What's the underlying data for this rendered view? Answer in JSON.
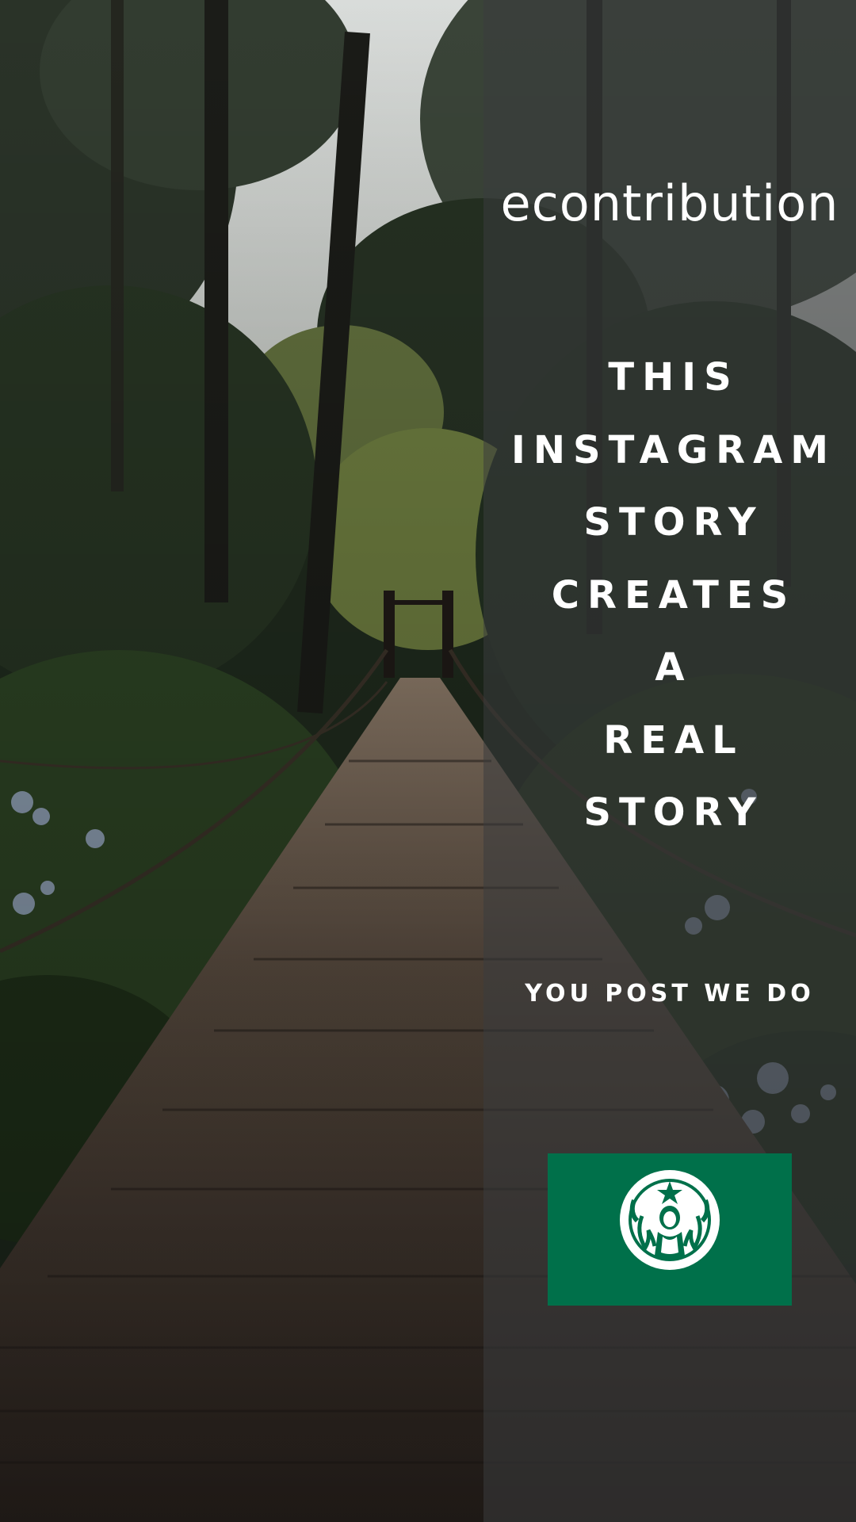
{
  "story": {
    "brand": "econtribution",
    "headline_words": [
      "THIS",
      "INSTAGRAM",
      "STORY",
      "CREATES",
      "A",
      "REAL",
      "STORY"
    ],
    "tagline": "YOU POST WE DO"
  },
  "background": {
    "subject": "wooden suspension bridge in forest",
    "overlay_color": "#3a3c3e"
  },
  "sponsor_logo": {
    "icon": "siren-icon",
    "background_color": "#00704a"
  }
}
